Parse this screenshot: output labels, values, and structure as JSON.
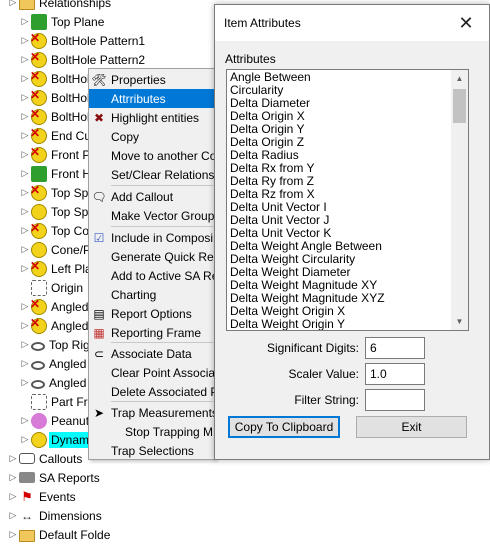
{
  "tree": {
    "items": [
      {
        "label": "Relationships",
        "icon": "folder-icon"
      },
      {
        "label": "Top Plane",
        "icon": "plane-icon"
      },
      {
        "label": "BoltHole Pattern1",
        "icon": "error-icon"
      },
      {
        "label": "BoltHole Pattern2",
        "icon": "error-icon"
      },
      {
        "label": "BoltHole",
        "icon": "error-icon"
      },
      {
        "label": "BoltHole",
        "icon": "error-icon"
      },
      {
        "label": "BoltHole",
        "icon": "error-icon"
      },
      {
        "label": "End Cutc",
        "icon": "error-icon"
      },
      {
        "label": "Front Pla",
        "icon": "error-icon"
      },
      {
        "label": "Front Hol",
        "icon": "plane-icon"
      },
      {
        "label": "Top Sphe",
        "icon": "error-icon"
      },
      {
        "label": "Top Sphe",
        "icon": "sphere-icon"
      },
      {
        "label": "Top Cone",
        "icon": "error-icon"
      },
      {
        "label": "Cone/Pla",
        "icon": "sphere-icon"
      },
      {
        "label": "Left Plan",
        "icon": "error-icon"
      },
      {
        "label": "Origin",
        "icon": "origin-icon"
      },
      {
        "label": "Angled C",
        "icon": "error-icon"
      },
      {
        "label": "Angled P",
        "icon": "error-icon"
      },
      {
        "label": "Top Righ",
        "icon": "ring-icon"
      },
      {
        "label": "Angled C",
        "icon": "ring-icon"
      },
      {
        "label": "Angled C",
        "icon": "ring-icon"
      },
      {
        "label": "Part Fram",
        "icon": "origin-icon"
      },
      {
        "label": "Peanut t",
        "icon": "peanut-icon"
      },
      {
        "label": "Dynamic",
        "icon": "sphere-icon"
      },
      {
        "label": "Callouts",
        "icon": "callout-icon"
      },
      {
        "label": "SA Reports",
        "icon": "report-icon"
      },
      {
        "label": "Events",
        "icon": "flag-icon"
      },
      {
        "label": "Dimensions",
        "icon": "dimension-icon"
      },
      {
        "label": "Default Folde",
        "icon": "folder-icon"
      }
    ]
  },
  "context_menu": {
    "items": [
      {
        "label": "Properties",
        "icon": "tools-icon"
      },
      {
        "label": "Attrributes",
        "icon": ""
      },
      {
        "label": "Highlight entities",
        "icon": "cross-icon"
      },
      {
        "label": "Copy",
        "icon": ""
      },
      {
        "label": "Move to another Co",
        "icon": ""
      },
      {
        "label": "Set/Clear Relationsh",
        "icon": ""
      },
      {
        "label": "Add Callout",
        "icon": "callout-icon"
      },
      {
        "label": "Make Vector Group",
        "icon": ""
      },
      {
        "label": "Include in Composi",
        "icon": "checkbox-icon"
      },
      {
        "label": "Generate Quick Rep",
        "icon": ""
      },
      {
        "label": "Add to Active SA Re",
        "icon": ""
      },
      {
        "label": "Charting",
        "icon": ""
      },
      {
        "label": "Report Options",
        "icon": "report-icon"
      },
      {
        "label": "Reporting Frame",
        "icon": "frame-icon"
      },
      {
        "label": "Associate Data",
        "icon": "link-icon"
      },
      {
        "label": "Clear Point Associat",
        "icon": ""
      },
      {
        "label": "Delete Associated P",
        "icon": ""
      },
      {
        "label": "Trap Measurements",
        "icon": "arrow-icon"
      },
      {
        "label": "Stop Trapping M",
        "icon": ""
      },
      {
        "label": "Trap Selections",
        "icon": ""
      }
    ]
  },
  "dialog": {
    "title": "Item Attributes",
    "attributes_label": "Attributes",
    "attributes": [
      "Angle Between",
      "Circularity",
      "Delta Diameter",
      "Delta Origin X",
      "Delta Origin Y",
      "Delta Origin Z",
      "Delta Radius",
      "Delta Rx from Y",
      "Delta Ry from Z",
      "Delta Rz from X",
      "Delta Unit Vector I",
      "Delta Unit Vector J",
      "Delta Unit Vector K",
      "Delta Weight Angle Between",
      "Delta Weight Circularity",
      "Delta Weight Diameter",
      "Delta Weight Magnitude XY",
      "Delta Weight Magnitude XYZ",
      "Delta Weight Origin X",
      "Delta Weight Origin Y"
    ],
    "significant_digits_label": "Significant Digits:",
    "significant_digits_value": "6",
    "scaler_value_label": "Scaler Value:",
    "scaler_value_value": "1.0",
    "filter_string_label": "Filter String:",
    "filter_string_value": "",
    "copy_button": "Copy To Clipboard",
    "exit_button": "Exit",
    "accent_color": "#0078d7"
  }
}
